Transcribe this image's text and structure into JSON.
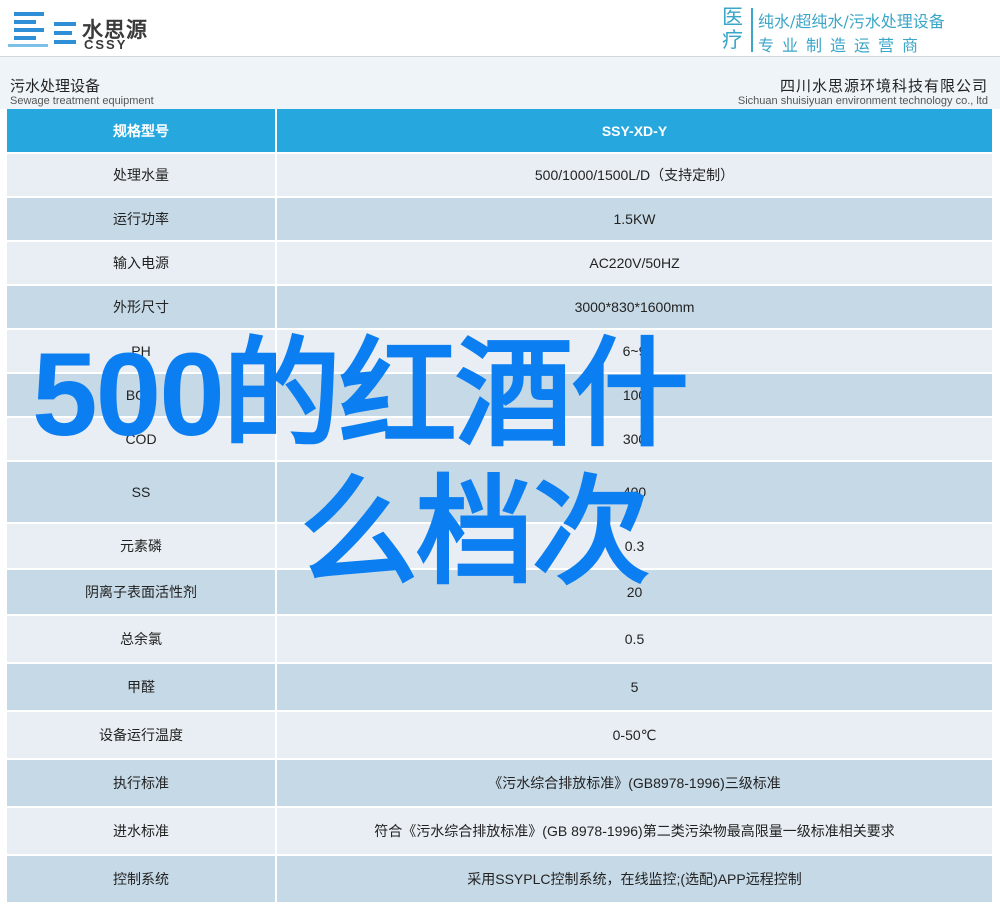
{
  "header": {
    "logo_cn": "水思源",
    "logo_en": "CSSY",
    "slogan_big": "医疗",
    "slogan_line1": "纯水/超纯水/污水处理设备",
    "slogan_line2": "专业制造运营商"
  },
  "sub_header": {
    "left_cn": "污水处理设备",
    "left_en": "Sewage treatment equipment",
    "right_cn": "四川水思源环境科技有限公司",
    "right_en": "Sichuan shuisiyuan environment technology co., ltd"
  },
  "table": {
    "header": {
      "label": "规格型号",
      "value": "SSY-XD-Y"
    },
    "rows": [
      {
        "label": "处理水量",
        "value": "500/1000/1500L/D（支持定制）"
      },
      {
        "label": "运行功率",
        "value": "1.5KW"
      },
      {
        "label": "输入电源",
        "value": "AC220V/50HZ"
      },
      {
        "label": "外形尺寸",
        "value": "3000*830*1600mm"
      },
      {
        "label": "PH",
        "value": "6~9"
      },
      {
        "label": "BOD",
        "value": "100"
      },
      {
        "label": "COD",
        "value": "300"
      },
      {
        "label": "SS",
        "value": "400"
      },
      {
        "label": "元素磷",
        "value": "0.3"
      },
      {
        "label": "阴离子表面活性剂",
        "value": "20"
      },
      {
        "label": "总余氯",
        "value": "0.5"
      },
      {
        "label": "甲醛",
        "value": "5"
      },
      {
        "label": "设备运行温度",
        "value": "0-50℃"
      },
      {
        "label": "执行标准",
        "value": "《污水综合排放标准》(GB8978-1996)三级标准"
      },
      {
        "label": "进水标准",
        "value": "符合《污水综合排放标准》(GB 8978-1996)第二类污染物最高限量一级标准相关要求"
      },
      {
        "label": "控制系统",
        "value": "采用SSYPLC控制系统，在线监控;(选配)APP远程控制"
      }
    ]
  },
  "overlay": {
    "line1": "500的红酒什",
    "line2": "么档次"
  }
}
